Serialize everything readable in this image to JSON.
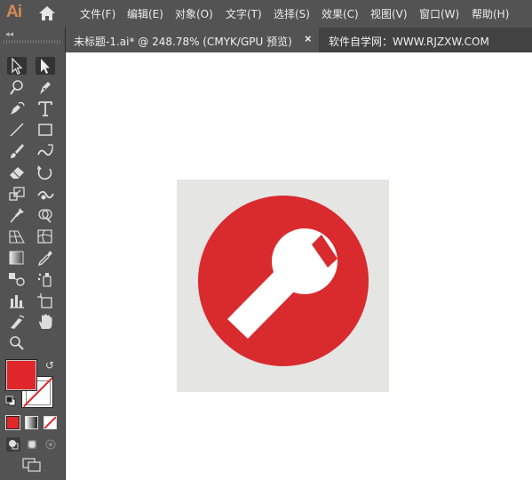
{
  "app": {
    "logo": "Ai"
  },
  "menu": [
    {
      "id": "file",
      "label": "文件(F)"
    },
    {
      "id": "edit",
      "label": "编辑(E)"
    },
    {
      "id": "object",
      "label": "对象(O)"
    },
    {
      "id": "type",
      "label": "文字(T)"
    },
    {
      "id": "select",
      "label": "选择(S)"
    },
    {
      "id": "effect",
      "label": "效果(C)"
    },
    {
      "id": "view",
      "label": "视图(V)"
    },
    {
      "id": "window",
      "label": "窗口(W)"
    },
    {
      "id": "help",
      "label": "帮助(H)"
    }
  ],
  "document_tab": {
    "title": "未标题-1.ai* @ 248.78% (CMYK/GPU 预览)",
    "close": "×"
  },
  "watermark": "软件自学网：WWW.RJZXW.COM",
  "toolbar": {
    "collapse": "◂◂",
    "tools": [
      "selection-tool",
      "direct-selection-tool",
      "magic-wand-tool",
      "pen-tool",
      "curvature-tool",
      "type-tool",
      "line-segment-tool",
      "rectangle-tool",
      "paintbrush-tool",
      "shaper-tool",
      "eraser-tool",
      "rotate-tool",
      "scale-tool",
      "warp-tool",
      "puppet-warp-tool",
      "shape-builder-tool",
      "perspective-grid-tool",
      "mesh-tool",
      "gradient-tool",
      "eyedropper-tool",
      "blend-tool",
      "symbol-sprayer-tool",
      "column-graph-tool",
      "artboard-tool",
      "slice-tool",
      "hand-tool",
      "zoom-tool"
    ],
    "fill_color": "#e0262b",
    "stroke": "none"
  },
  "colors": {
    "panel": "#535353",
    "canvas": "#ffffff",
    "artwork_bg": "#e5e5e3",
    "artwork_circle": "#d92a2e",
    "wrench": "#ffffff"
  },
  "artwork": {
    "icon": "wrench-icon"
  }
}
